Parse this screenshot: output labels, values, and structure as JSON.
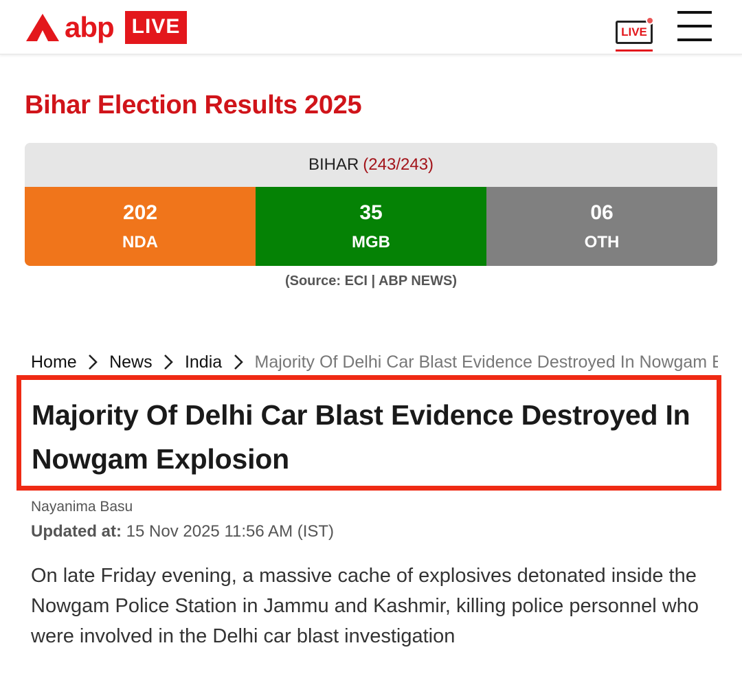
{
  "header": {
    "logo_text": "abp",
    "logo_badge": "LIVE",
    "live_tv_label": "LIVE",
    "colors": {
      "brand_red": "#e3171c"
    },
    "icons": [
      "abp-triangle-logo-icon",
      "live-tv-icon",
      "hamburger-menu-icon"
    ]
  },
  "election": {
    "title": "Bihar Election Results 2025",
    "state": "BIHAR",
    "seats_count": "(243/243)",
    "parties": [
      {
        "seats": "202",
        "name": "NDA",
        "color": "#f0751b"
      },
      {
        "seats": "35",
        "name": "MGB",
        "color": "#058205"
      },
      {
        "seats": "06",
        "name": "OTH",
        "color": "#808080"
      }
    ],
    "source": "(Source:  ECI | ABP NEWS)"
  },
  "breadcrumb": {
    "items": [
      "Home",
      "News",
      "India"
    ],
    "current": "Majority Of Delhi Car Blast Evidence Destroyed In Nowgam Explosion"
  },
  "article": {
    "headline": "Majority Of Delhi Car Blast Evidence Destroyed In Nowgam Explosion",
    "author": "Nayanima Basu",
    "updated_label": "Updated at:",
    "updated_value": " 15 Nov 2025 11:56 AM (IST)",
    "summary": "On late Friday evening, a massive cache of explosives detonated inside the Nowgam Police Station in Jammu and Kashmir, killing police personnel who were involved in the Delhi car blast investigation",
    "highlight_color": "#ef2a14"
  }
}
